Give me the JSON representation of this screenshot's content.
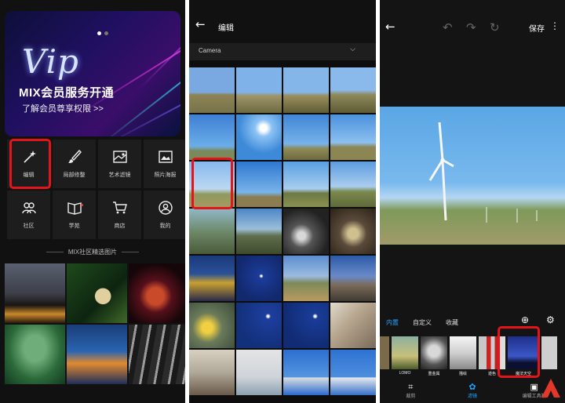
{
  "panel1": {
    "vip_script": "Vip",
    "vip_title": "MIX会员服务开通",
    "vip_sub": "了解会员尊享权限 >>",
    "tools": [
      {
        "label": "编辑",
        "icon": "magic-wand-icon"
      },
      {
        "label": "局部修整",
        "icon": "brush-icon"
      },
      {
        "label": "艺术滤镜",
        "icon": "art-filter-icon"
      },
      {
        "label": "照片海报",
        "icon": "poster-icon"
      },
      {
        "label": "社区",
        "icon": "community-icon"
      },
      {
        "label": "学苑",
        "icon": "book-icon"
      },
      {
        "label": "商店",
        "icon": "cart-icon"
      },
      {
        "label": "我的",
        "icon": "profile-icon"
      }
    ],
    "section_title": "MIX社区精选图片"
  },
  "panel2": {
    "title": "编辑",
    "album": "Camera"
  },
  "panel3": {
    "save": "保存",
    "tabs": [
      "内置",
      "自定义",
      "收藏"
    ],
    "filters": [
      "",
      "LOMO",
      "重金属",
      "描绘",
      "迹色",
      "魔法天空",
      ""
    ],
    "bottom": [
      "裁剪",
      "滤镜",
      "编辑工具箱"
    ]
  },
  "colors": {
    "accent": "#1fa3ff",
    "highlight": "#e5141a"
  }
}
